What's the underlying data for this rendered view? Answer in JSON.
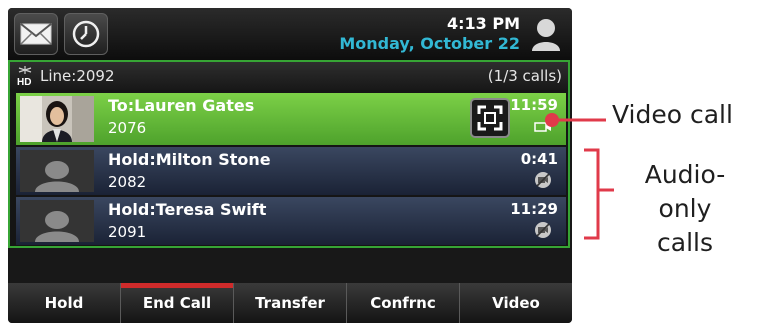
{
  "status_bar": {
    "time": "4:13 PM",
    "date": "Monday, October 22"
  },
  "line": {
    "label": "Line:2092",
    "call_count": "(1/3 calls)"
  },
  "calls": [
    {
      "name": "To:Lauren Gates",
      "number": "2076",
      "duration": "11:59"
    },
    {
      "name": "Hold:Milton Stone",
      "number": "2082",
      "duration": "0:41"
    },
    {
      "name": "Hold:Teresa Swift",
      "number": "2091",
      "duration": "11:29"
    }
  ],
  "softkeys": [
    "Hold",
    "End Call",
    "Transfer",
    "Confrnc",
    "Video"
  ],
  "annotations": {
    "video_call": "Video call",
    "audio_only_line1": "Audio-only",
    "audio_only_line2": "calls"
  },
  "colors": {
    "active_call": "#5cb335",
    "line_border": "#37a535",
    "date_text": "#32b8d4",
    "end_call_accent": "#cf2b2b",
    "annotation": "#e03a4a"
  },
  "icons": {
    "messages": "envelope-icon",
    "history": "clock-icon",
    "profile": "person-icon",
    "hd": "hd-audio-icon",
    "fullscreen": "fullscreen-icon",
    "video": "camera-icon",
    "no_video": "video-off-icon"
  }
}
